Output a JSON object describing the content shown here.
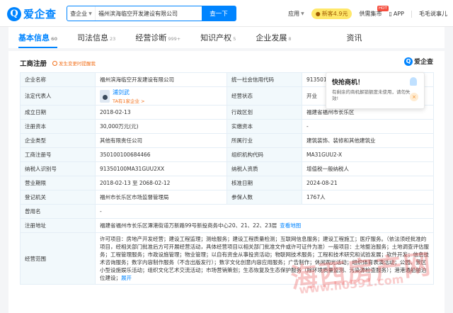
{
  "header": {
    "logo_mark": "Q",
    "logo_text": "爱企查",
    "search_type": "查企业",
    "search_value": "福州滨海临空开发建设有限公司",
    "search_button": "查一下",
    "nav": {
      "app_menu": "应用",
      "newcomer": "新客4.9元",
      "hot_badge": "HOT",
      "market": "供需集市",
      "app": "APP",
      "user": "毛毛说事儿"
    }
  },
  "tabs": [
    {
      "label": "基本信息",
      "count": "60",
      "active": true
    },
    {
      "label": "司法信息",
      "count": "23",
      "active": false
    },
    {
      "label": "经营诊断",
      "count": "999+",
      "active": false
    },
    {
      "label": "知识产权",
      "count": "5",
      "active": false
    },
    {
      "label": "企业发展",
      "count": "8",
      "active": false
    },
    {
      "label": "资讯",
      "count": "",
      "active": false
    }
  ],
  "section": {
    "title": "工商注册",
    "tip": "发生变更时提醒我",
    "brand": "爱企查",
    "brand_mark": "Q"
  },
  "popup": {
    "title": "快抢商机！",
    "text": "有剩余的商机解锁额度未使用，请勿失效!",
    "close": "×"
  },
  "rows": [
    [
      {
        "label": "企业名称",
        "value": "福州滨海临空开发建设有限公司"
      },
      {
        "label": "统一社会信用代码",
        "value": "91350100MA31GUU2XX"
      }
    ],
    [
      {
        "label": "法定代表人",
        "value": "浦剑武",
        "sub": "TA有1家企业 >"
      },
      {
        "label": "经营状态",
        "value": "开业"
      }
    ],
    [
      {
        "label": "成立日期",
        "value": "2018-02-13"
      },
      {
        "label": "行政区划",
        "value": "福建省福州市长乐区"
      }
    ],
    [
      {
        "label": "注册资本",
        "value": "30,000万元(元)"
      },
      {
        "label": "实缴资本",
        "value": "-"
      }
    ],
    [
      {
        "label": "企业类型",
        "value": "其他有限责任公司"
      },
      {
        "label": "所属行业",
        "value": "建筑装饰、装修和其他建筑业"
      }
    ],
    [
      {
        "label": "工商注册号",
        "value": "350100100684466"
      },
      {
        "label": "组织机构代码",
        "value": "MA31GUU2-X"
      }
    ],
    [
      {
        "label": "纳税人识别号",
        "value": "91350100MA31GUU2XX"
      },
      {
        "label": "纳税人资质",
        "value": "增值税一般纳税人"
      }
    ],
    [
      {
        "label": "营业期限",
        "value": "2018-02-13 至 2068-02-12"
      },
      {
        "label": "核准日期",
        "value": "2024-08-21"
      }
    ],
    [
      {
        "label": "登记机关",
        "value": "福州市长乐区市场监督管理局"
      },
      {
        "label": "参保人数",
        "value": "1767人"
      }
    ]
  ],
  "former_name": {
    "label": "曾用名",
    "value": "-"
  },
  "address": {
    "label": "注册地址",
    "value": "福建省福州市长乐区潭港街道万新路99号新投商务中心20、21、22、23层",
    "link": "查看地图"
  },
  "scope": {
    "label": "经营范围",
    "value": "许可项目：房地产开发经营；建设工程监理；测绘服务；建设工程质量检测；互联网信息服务；建设工程施工；医疗服务。（依法须经批准的项目，经相关部门批准后方可开展经营活动，具体经营项目以相关部门批准文件或许可证件为准）一般项目：土地整治服务；土地调查评估服务；工程管理服务；市政设施管理；物业管理；以自有资金从事投资活动；物联网技术服务；工程和技术研究和试验发展；软件开发；信息技术咨询服务；数字内容制作服务（不含出版发行）；数字文化创意内容应用服务；广告制作；休闲观光活动；组织体育表演活动；公园、景区小型设施娱乐活动；组织文化艺术交流活动；市场营销策划；生态恢复及生态保护服务（除环境质量监测、污染源检查服务）；港港通船舶泊位建设；",
    "expand": "展开"
  },
  "watermark": {
    "title": "海西房产网",
    "url": "www.h0591.com"
  }
}
